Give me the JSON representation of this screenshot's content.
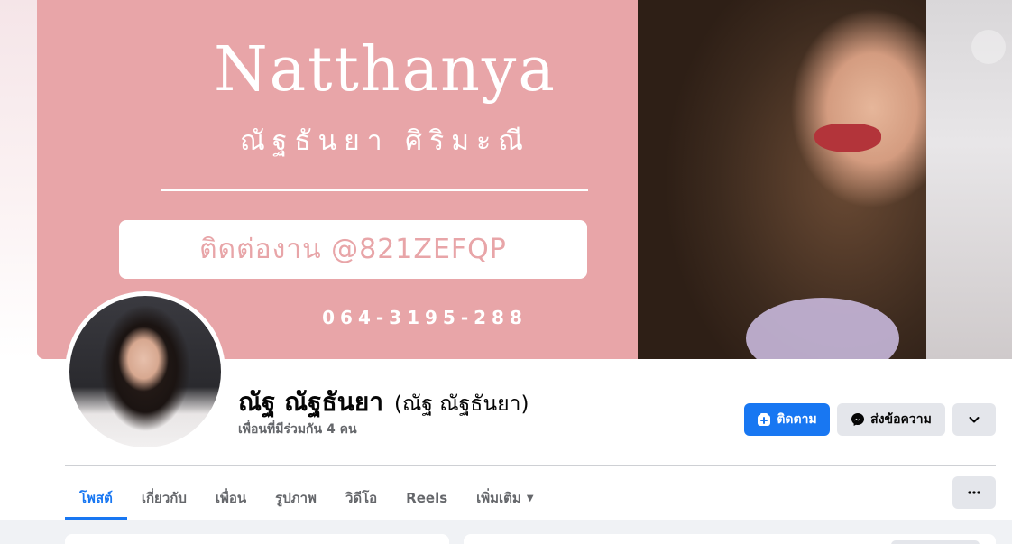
{
  "cover": {
    "title": "Natthanya",
    "subtitle": "ณัฐธันยา ศิริมะณี",
    "contact": "ติดต่องาน @821ZEFQP",
    "phone": "064-3195-288"
  },
  "profile": {
    "name": "ณัฐ ณัฐธันยา",
    "alternate_name": "(ณัฐ ณัฐธันยา)",
    "mutual_friends": "เพื่อนที่มีร่วมกัน 4 คน"
  },
  "actions": {
    "follow_label": "ติดตาม",
    "message_label": "ส่งข้อความ"
  },
  "tabs": [
    {
      "label": "โพสต์",
      "active": true
    },
    {
      "label": "เกี่ยวกับ",
      "active": false
    },
    {
      "label": "เพื่อน",
      "active": false
    },
    {
      "label": "รูปภาพ",
      "active": false
    },
    {
      "label": "วิดีโอ",
      "active": false
    },
    {
      "label": "Reels",
      "active": false
    },
    {
      "label": "เพิ่มเติม",
      "active": false
    }
  ],
  "icons": {
    "follow": "follow-plus-icon",
    "message": "messenger-icon",
    "more": "chevron-down-icon",
    "options": "ellipsis-icon",
    "tab_more": "caret-down-icon"
  },
  "colors": {
    "accent": "#1877f2",
    "cover_pink": "#e8a5a8",
    "button_gray": "#e4e6eb"
  }
}
